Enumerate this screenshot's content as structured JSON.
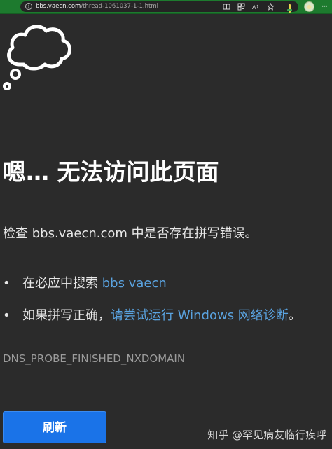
{
  "browser": {
    "url_domain": "bbs.vaecn.com",
    "url_path": "/thread-1061037-1-1.html",
    "info_icon": "info-icon",
    "toolbar_icons": [
      "reading-mode-icon",
      "qr-code-icon",
      "read-aloud-icon",
      "favorite-icon",
      "extension-icon",
      "profile-avatar",
      "more-menu-icon"
    ]
  },
  "error_page": {
    "headline": "嗯… 无法访问此页面",
    "message": "检查 bbs.vaecn.com 中是否存在拼写错误。",
    "suggestions": [
      {
        "prefix": "在必应中搜索 ",
        "link": "bbs vaecn",
        "suffix": ""
      },
      {
        "prefix": "如果拼写正确，",
        "link": "请尝试运行 Windows 网络诊断",
        "suffix": "。"
      }
    ],
    "bullet": "•",
    "error_code": "DNS_PROBE_FINISHED_NXDOMAIN",
    "reload_label": "刷新"
  },
  "watermark": {
    "text": "知乎 @罕见病友临行疾呼"
  },
  "colors": {
    "background": "#2b2b2b",
    "topbar": "#1d7a2e",
    "link": "#5aa3e0",
    "button": "#1a73e8"
  }
}
